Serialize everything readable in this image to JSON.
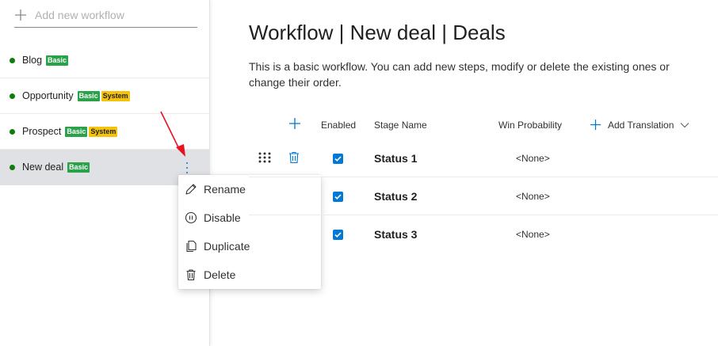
{
  "sidebar": {
    "add_placeholder": "Add new workflow",
    "items": [
      {
        "name": "Blog",
        "badges": [
          "Basic"
        ]
      },
      {
        "name": "Opportunity",
        "badges": [
          "Basic",
          "System"
        ]
      },
      {
        "name": "Prospect",
        "badges": [
          "Basic",
          "System"
        ]
      },
      {
        "name": "New deal",
        "badges": [
          "Basic"
        ]
      }
    ]
  },
  "context_menu": {
    "items": [
      "Rename",
      "Disable",
      "Duplicate",
      "Delete"
    ]
  },
  "main": {
    "title": "Workflow | New deal | Deals",
    "description": "This is a basic workflow. You can add new steps, modify or delete the existing ones or change their order.",
    "table": {
      "headers": {
        "enabled": "Enabled",
        "stage_name": "Stage Name",
        "win_probability": "Win Probability",
        "add_translation": "Add Translation"
      },
      "rows": [
        {
          "enabled": true,
          "stage_name": "Status 1",
          "win_probability": "<None>"
        },
        {
          "enabled": true,
          "stage_name": "Status 2",
          "win_probability": "<None>"
        },
        {
          "enabled": true,
          "stage_name": "Status 3",
          "win_probability": "<None>"
        }
      ]
    }
  },
  "colors": {
    "accent": "#0078d4",
    "status_dot": "#107c10",
    "badge_basic": "#2aa24a",
    "badge_system": "#f3c40b",
    "annotation_arrow": "#e81123"
  }
}
